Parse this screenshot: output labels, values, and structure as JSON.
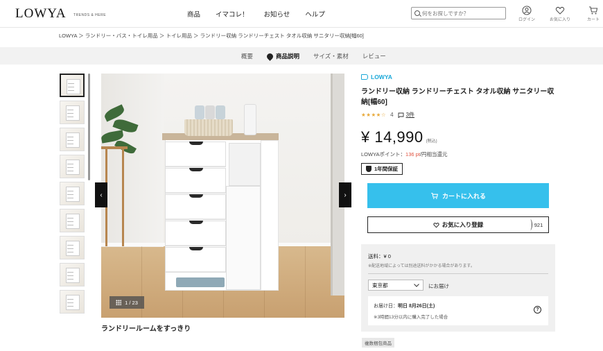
{
  "header": {
    "logo": "LOWYA",
    "logo_sub": "TRENDS & HERE",
    "nav": [
      "商品",
      "イマコレ！",
      "お知らせ",
      "ヘルプ"
    ],
    "search_placeholder": "何をお探しですか？",
    "icons": [
      {
        "label": "ログイン",
        "icon": "user-icon"
      },
      {
        "label": "お気に入り",
        "icon": "heart-icon"
      },
      {
        "label": "カート",
        "icon": "cart-icon"
      }
    ]
  },
  "breadcrumb": "LOWYA ＞ ランドリー・バス・トイレ用品 ＞ トイレ用品 ＞ ランドリー収納 ランドリーチェスト タオル収納 サニタリー収納[幅60]",
  "tabs": [
    "概要",
    "商品説明",
    "サイズ・素材",
    "レビュー"
  ],
  "gallery": {
    "counter": "1 / 23",
    "caption": "ランドリールームをすっきり",
    "prev": "‹",
    "next": "›"
  },
  "product": {
    "brand": "LOWYA",
    "title": "ランドリー収納 ランドリーチェスト タオル収納 サニタリー収納[幅60]",
    "rating_value": 4,
    "rating_stars": "★★★★☆",
    "rating_text": "4",
    "review_count": "3件",
    "price": "¥ 14,990",
    "tax": "(税込)",
    "points_prefix": "LOWYAポイント：",
    "points_value": "136 pt",
    "points_suffix": "/円相当還元",
    "warranty": "1年間保証",
    "cart_button": "カートに入れる",
    "favorite_button": "お気に入り登録",
    "favorite_count": "921"
  },
  "shipping": {
    "fee": "送料：¥ 0",
    "note": "※配送地域によっては別途送料がかかる場合があります。",
    "prefecture": "東京都",
    "prefecture_note": "にお届け",
    "delivery_label": "お届け日：",
    "delivery_date": "明日 8月26日(土)",
    "delivery_note": "※3時間13分以内に購入完了した場合"
  },
  "multi_tag": "複数梱包商品",
  "colors": {
    "accent": "#36c0ec",
    "brand": "#1aa8d8",
    "points": "#e0503c",
    "stars": "#e8a93a"
  }
}
